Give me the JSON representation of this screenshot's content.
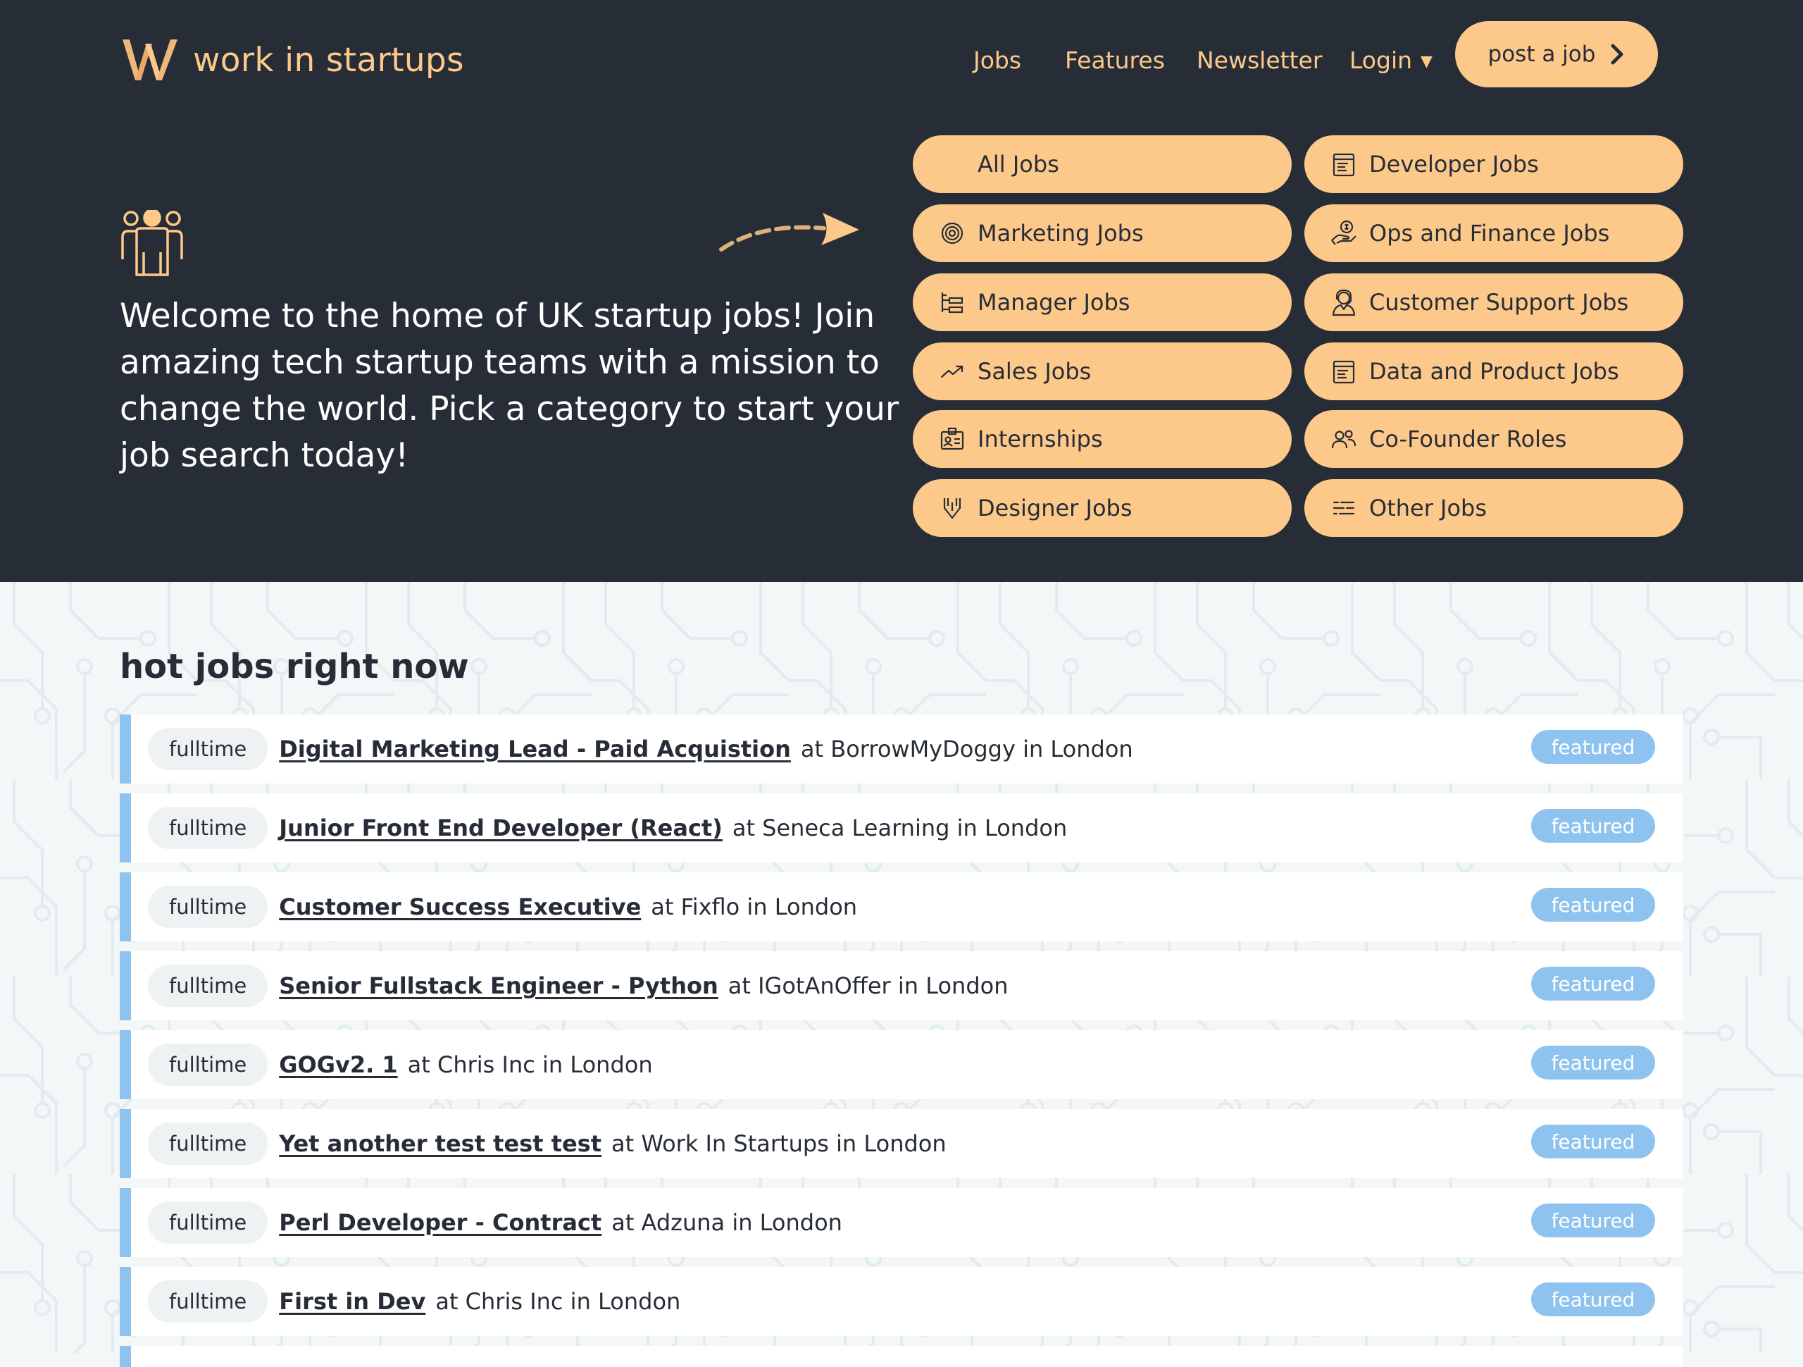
{
  "header": {
    "logo_text": "work in startups",
    "nav": {
      "jobs": "Jobs",
      "features": "Features",
      "newsletter": "Newsletter",
      "login": "Login",
      "login_caret": "▼"
    },
    "post_job": "post a job"
  },
  "hero": {
    "intro": "Welcome to the home of UK startup jobs! Join amazing tech startup teams with a mission to change the world. Pick a category to start your job search today!"
  },
  "categories": [
    {
      "label": "All Jobs",
      "icon": "none"
    },
    {
      "label": "Developer Jobs",
      "icon": "document-icon"
    },
    {
      "label": "Marketing Jobs",
      "icon": "target-icon"
    },
    {
      "label": "Ops and Finance Jobs",
      "icon": "hand-coin-icon"
    },
    {
      "label": "Manager Jobs",
      "icon": "org-chart-icon"
    },
    {
      "label": "Customer Support Jobs",
      "icon": "headset-icon"
    },
    {
      "label": "Sales Jobs",
      "icon": "trend-up-icon"
    },
    {
      "label": "Data and Product Jobs",
      "icon": "document-icon"
    },
    {
      "label": "Internships",
      "icon": "id-badge-icon"
    },
    {
      "label": "Co-Founder Roles",
      "icon": "users-icon"
    },
    {
      "label": "Designer Jobs",
      "icon": "pen-icon"
    },
    {
      "label": "Other Jobs",
      "icon": "list-icon"
    }
  ],
  "hot_jobs": {
    "title": "hot jobs right now",
    "items": [
      {
        "type": "fulltime",
        "title": "Digital Marketing Lead - Paid Acquistion",
        "rest": "at BorrowMyDoggy in London",
        "badge": "featured"
      },
      {
        "type": "fulltime",
        "title": "Junior Front End Developer (React)",
        "rest": "at Seneca Learning in London",
        "badge": "featured"
      },
      {
        "type": "fulltime",
        "title": "Customer Success Executive",
        "rest": "at Fixflo in London",
        "badge": "featured"
      },
      {
        "type": "fulltime",
        "title": "Senior Fullstack Engineer - Python",
        "rest": "at IGotAnOffer in London",
        "badge": "featured"
      },
      {
        "type": "fulltime",
        "title": "GOGv2. 1",
        "rest": "at Chris Inc in London",
        "badge": "featured"
      },
      {
        "type": "fulltime",
        "title": "Yet another test test test",
        "rest": "at Work In Startups in London",
        "badge": "featured"
      },
      {
        "type": "fulltime",
        "title": "Perl Developer - Contract",
        "rest": "at Adzuna in London",
        "badge": "featured"
      },
      {
        "type": "fulltime",
        "title": "First in Dev",
        "rest": "at Chris Inc in London",
        "badge": "featured"
      }
    ]
  },
  "colors": {
    "header_bg": "#272d36",
    "accent": "#fdc98a",
    "featured": "#8fc3ef",
    "page_bg": "#f3f7f8"
  }
}
